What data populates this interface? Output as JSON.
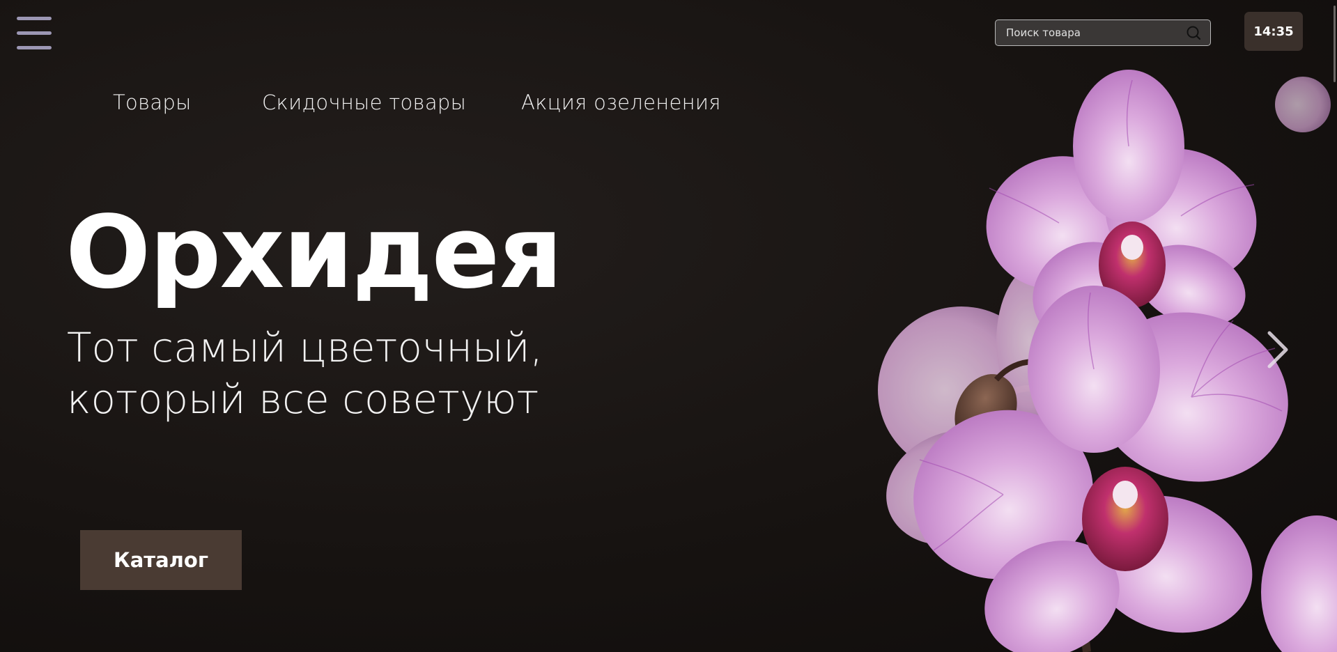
{
  "header": {
    "menu_icon": "hamburger-menu-icon",
    "search": {
      "placeholder": "Поиск товара",
      "value": "",
      "icon": "search-icon"
    },
    "clock": "14:35"
  },
  "nav": {
    "items": [
      {
        "label": "Товары"
      },
      {
        "label": "Скидочные товары"
      },
      {
        "label": "Акция озеленения"
      }
    ]
  },
  "hero": {
    "title": "Орхидея",
    "subtitle_line1": "Тот самый цветочный,",
    "subtitle_line2": "который все советуют",
    "cta_label": "Каталог",
    "next_icon": "chevron-right-icon"
  },
  "colors": {
    "background": "#141110",
    "menu_icon": "#9c97b4",
    "accent_button": "#4a3b33",
    "clock_bg": "#3a302b",
    "flower_petal": "#d9a6d9",
    "flower_vein": "#a24bb0"
  }
}
